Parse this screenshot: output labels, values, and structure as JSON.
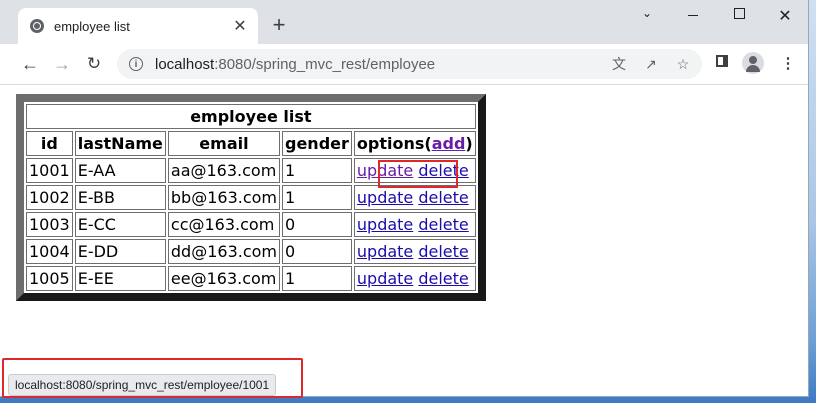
{
  "browser": {
    "tab_title": "employee list",
    "tab_close": "✕",
    "new_tab": "+",
    "url_host": "localhost",
    "url_path": ":8080/spring_mvc_rest/employee"
  },
  "table": {
    "caption": "employee list",
    "headers": [
      "id",
      "lastName",
      "email",
      "gender"
    ],
    "options_label": "options(",
    "add_label": "add",
    "options_close": ")",
    "rows": [
      {
        "id": "1001",
        "lastName": "E-AA",
        "email": "aa@163.com",
        "gender": "1"
      },
      {
        "id": "1002",
        "lastName": "E-BB",
        "email": "bb@163.com",
        "gender": "1"
      },
      {
        "id": "1003",
        "lastName": "E-CC",
        "email": "cc@163.com",
        "gender": "0"
      },
      {
        "id": "1004",
        "lastName": "E-DD",
        "email": "dd@163.com",
        "gender": "0"
      },
      {
        "id": "1005",
        "lastName": "E-EE",
        "email": "ee@163.com",
        "gender": "1"
      }
    ],
    "update_label": "update",
    "delete_label": "delete"
  },
  "status_bar": {
    "hover_url": "localhost:8080/spring_mvc_rest/employee/1001"
  },
  "colors": {
    "link": "#1a0dab",
    "visited": "#681da8",
    "highlight": "#e0282a"
  }
}
